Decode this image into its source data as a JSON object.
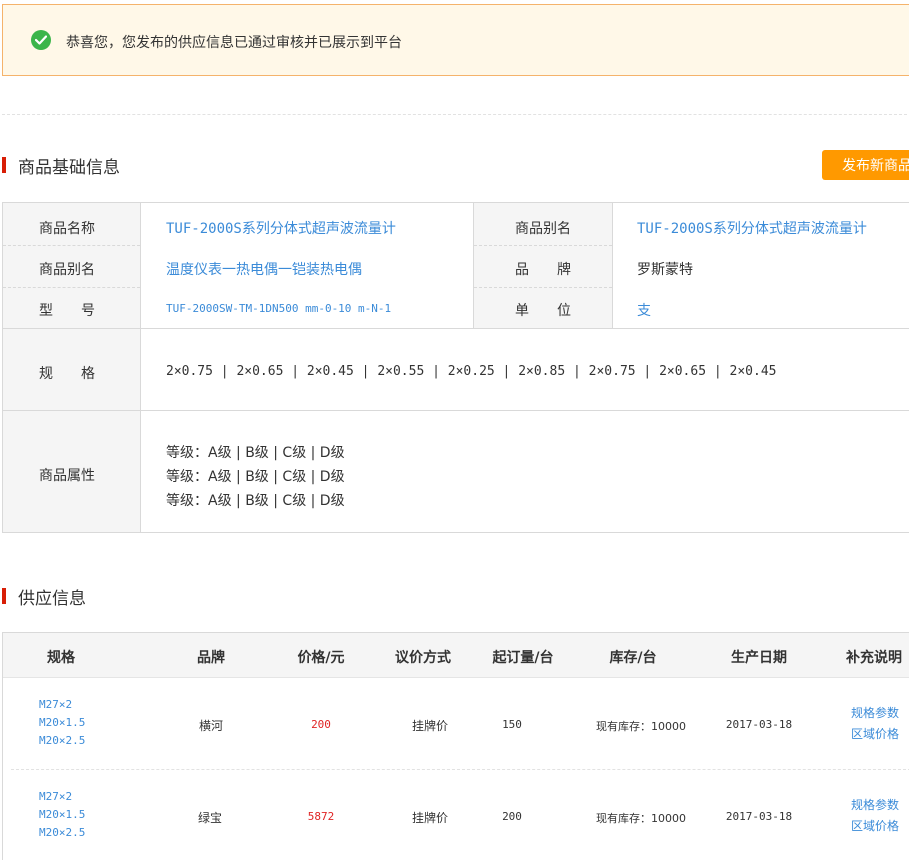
{
  "notice": {
    "message": "恭喜您，您发布的供应信息已通过审核并已展示到平台"
  },
  "base_section": {
    "title": "商品基础信息",
    "publish_button": "发布新商品"
  },
  "base_info": {
    "name_label": "商品名称",
    "name_value": "TUF-2000S系列分体式超声波流量计",
    "alias_label_right": "商品别名",
    "alias_value_right": "TUF-2000S系列分体式超声波流量计",
    "alias_label_left": "商品别名",
    "alias_value_left": "温度仪表一热电偶一铠装热电偶",
    "brand_label": "品　　牌",
    "brand_value": "罗斯蒙特",
    "model_label": "型　　号",
    "model_value": "TUF-2000SW-TM-1DN500 mm-0-10 m-N-1",
    "unit_label": "单　　位",
    "unit_value": "支",
    "spec_label": "规　　格",
    "spec_value": "2×0.75 | 2×0.65 | 2×0.45 | 2×0.55 | 2×0.25 | 2×0.85 | 2×0.75 | 2×0.65 | 2×0.45",
    "attr_label": "商品属性",
    "attr_lines": [
      "等级：A级 | B级 | C级 | D级",
      "等级：A级 | B级 | C级 | D级",
      "等级：A级 | B级 | C级 | D级"
    ]
  },
  "supply_section": {
    "title": "供应信息"
  },
  "supply_table": {
    "headers": [
      "规格",
      "品牌",
      "价格/元",
      "议价方式",
      "起订量/台",
      "库存/台",
      "生产日期",
      "补充说明"
    ],
    "rows": [
      {
        "specs": [
          "M27×2",
          "M20×1.5",
          "M20×2.5"
        ],
        "brand": "横河",
        "price": "200",
        "pricing": "挂牌价",
        "moq": "150",
        "stock": "现有库存：10000",
        "date": "2017-03-18",
        "links": [
          "规格参数",
          "区域价格"
        ]
      },
      {
        "specs": [
          "M27×2",
          "M20×1.5",
          "M20×2.5"
        ],
        "brand": "绿宝",
        "price": "5872",
        "pricing": "挂牌价",
        "moq": "200",
        "stock": "现有库存：10000",
        "date": "2017-03-18",
        "links": [
          "规格参数",
          "区域价格"
        ]
      }
    ]
  },
  "colors": {
    "accent_orange": "#ff9900",
    "success_green": "#3bb54a",
    "link_blue": "#3b8bd8",
    "price_red": "#e02424",
    "section_bar_red": "#d81e06"
  },
  "icons": {
    "success": "check-circle-icon"
  }
}
